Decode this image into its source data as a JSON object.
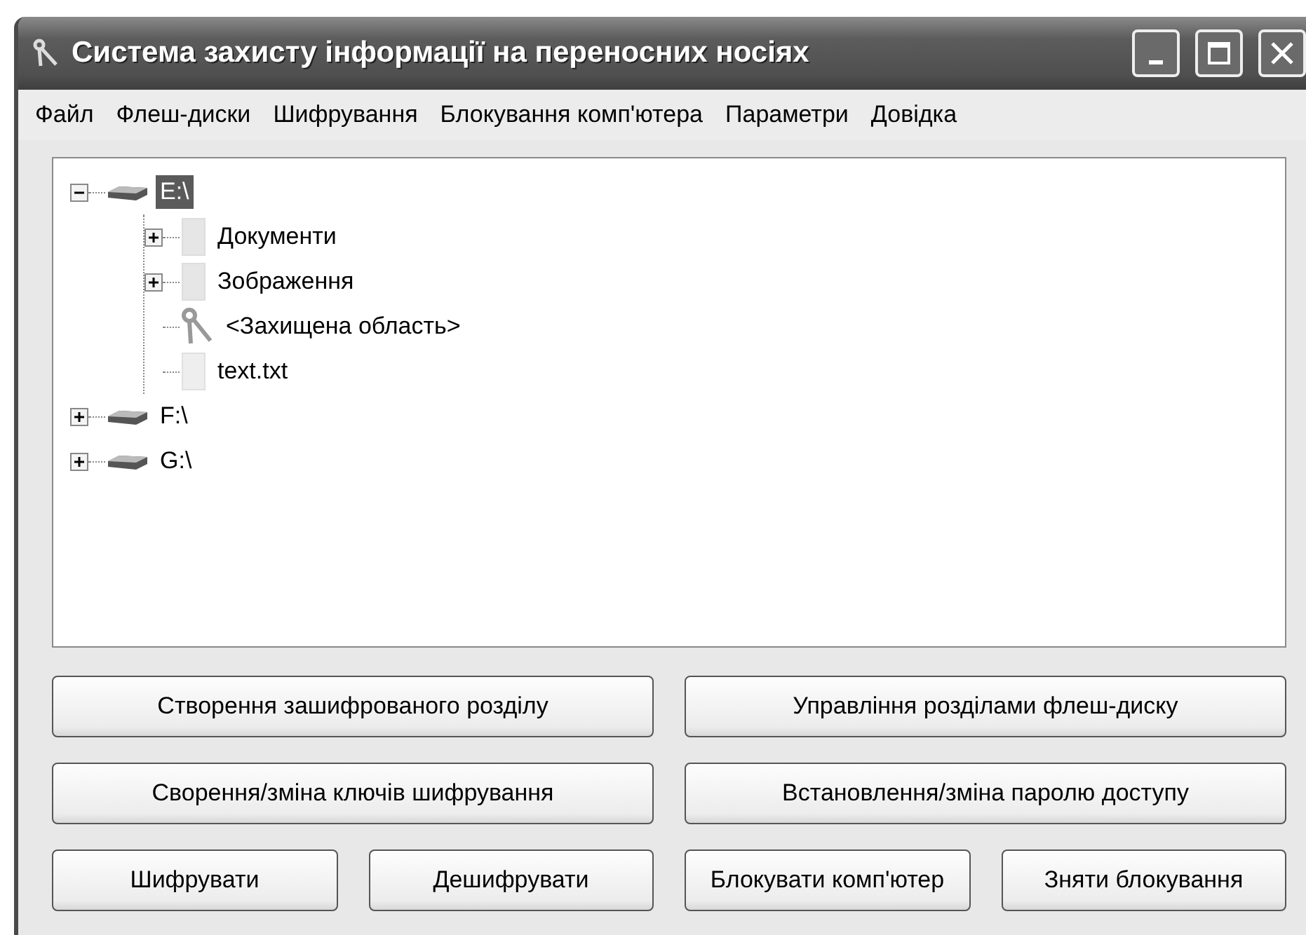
{
  "window": {
    "title": "Система захисту інформації на переносних носіях"
  },
  "menu": [
    "Файл",
    "Флеш-диски",
    "Шифрування",
    "Блокування комп'ютера",
    "Параметри",
    "Довідка"
  ],
  "tree": [
    {
      "label": "E:\\",
      "kind": "drive",
      "selected": true,
      "expanded": true,
      "children": [
        {
          "label": "Документи",
          "kind": "folder",
          "selected": false,
          "expanded": false
        },
        {
          "label": "Зображення",
          "kind": "folder",
          "selected": false,
          "expanded": false
        },
        {
          "label": "<Захищена область>",
          "kind": "key",
          "selected": false
        },
        {
          "label": "text.txt",
          "kind": "file",
          "selected": false
        }
      ]
    },
    {
      "label": "F:\\",
      "kind": "drive",
      "selected": false,
      "expanded": false
    },
    {
      "label": "G:\\",
      "kind": "drive",
      "selected": false,
      "expanded": false
    }
  ],
  "buttons": [
    [
      "Створення зашифрованого розділу",
      "Управління розділами флеш-диску"
    ],
    [
      "Сворення/зміна ключів шифрування",
      "Встановлення/зміна паролю доступу"
    ],
    [
      "Шифрувати",
      "Дешифрувати",
      "Блокувати комп'ютер",
      "Зняти блокування"
    ]
  ]
}
